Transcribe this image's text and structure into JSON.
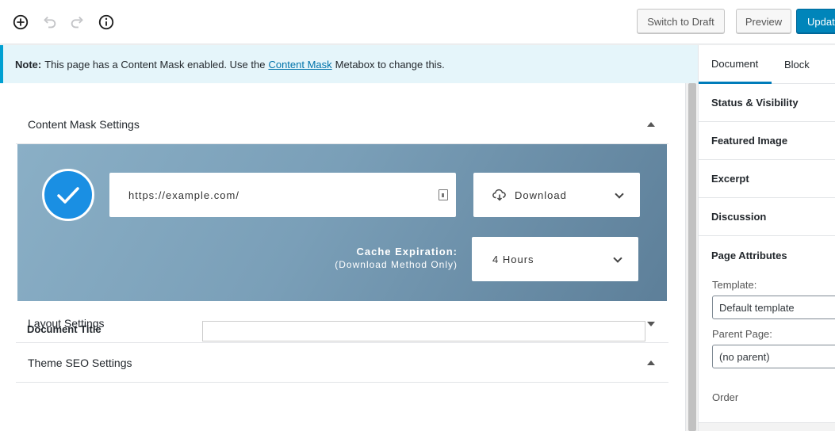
{
  "toolbar": {
    "switch_draft_label": "Switch to Draft",
    "preview_label": "Preview",
    "update_label": "Update"
  },
  "notice": {
    "prefix": "Note:",
    "text_before": "This page has a Content Mask enabled. Use the",
    "link": "Content Mask",
    "text_after": "Metabox to change this."
  },
  "content_mask": {
    "title": "Content Mask Settings",
    "url_value": "https://example.com/",
    "method_value": "Download",
    "cache_label": "Cache Expiration:",
    "cache_sublabel": "(Download Method Only)",
    "cache_value": "4 Hours"
  },
  "layout_settings": {
    "title": "Layout Settings"
  },
  "theme_seo": {
    "title": "Theme SEO Settings",
    "document_title_label": "Document Title",
    "document_title_value": ""
  },
  "sidebar": {
    "tabs": [
      {
        "label": "Document",
        "active": true
      },
      {
        "label": "Block",
        "active": false
      }
    ],
    "sections": [
      "Status & Visibility",
      "Featured Image",
      "Excerpt",
      "Discussion",
      "Page Attributes"
    ],
    "template_label": "Template:",
    "template_value": "Default template",
    "parent_label": "Parent Page:",
    "parent_value": "(no parent)",
    "order_label": "Order"
  },
  "colors": {
    "primary": "#0085ba",
    "notice_border": "#00a0d2",
    "check_circle": "#1a8fe3",
    "tab_active": "#007cba"
  },
  "icons": [
    "add-block-icon",
    "undo-icon",
    "redo-icon",
    "info-icon",
    "checkmark-icon",
    "url-field-icon",
    "cloud-download-icon",
    "chevron-down-icon",
    "caret-up-icon",
    "caret-down-icon"
  ]
}
